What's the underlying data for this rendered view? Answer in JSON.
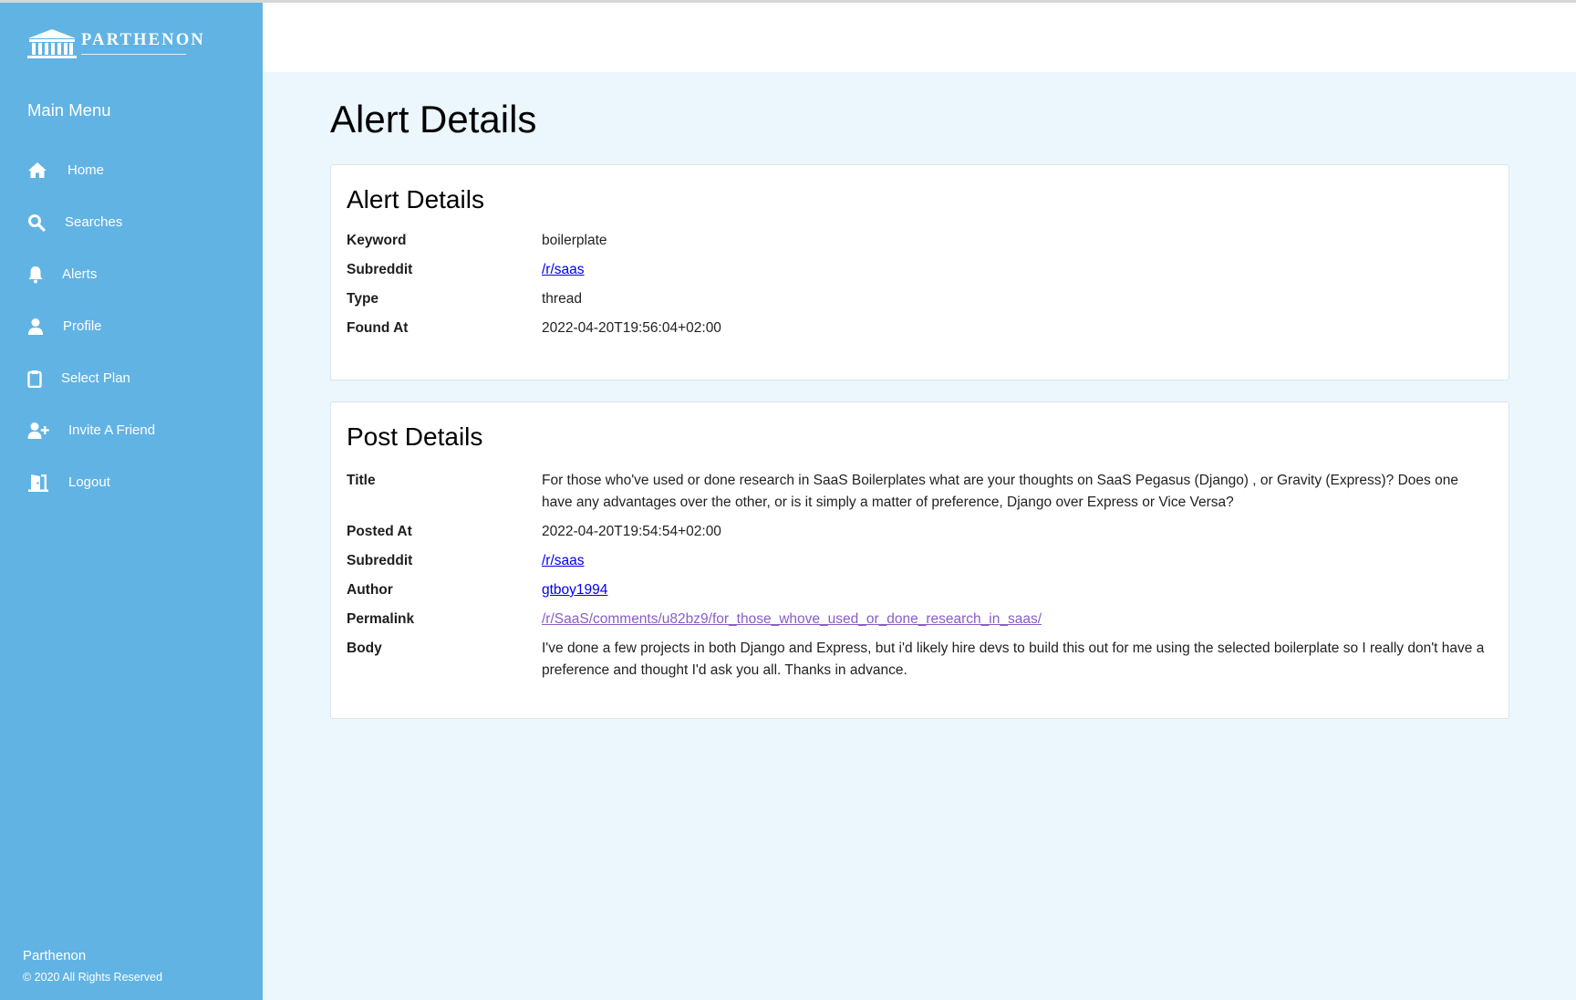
{
  "brand": {
    "logo_text": "PARTHENON"
  },
  "sidebar": {
    "menu_title": "Main Menu",
    "items": [
      {
        "label": "Home",
        "icon": "home-icon"
      },
      {
        "label": "Searches",
        "icon": "search-icon"
      },
      {
        "label": "Alerts",
        "icon": "bell-icon"
      },
      {
        "label": "Profile",
        "icon": "user-icon"
      },
      {
        "label": "Select Plan",
        "icon": "clipboard-icon"
      },
      {
        "label": "Invite A Friend",
        "icon": "user-plus-icon"
      },
      {
        "label": "Logout",
        "icon": "door-exit-icon"
      }
    ],
    "footer_name": "Parthenon",
    "footer_copy": "© 2020 All Rights Reserved"
  },
  "page": {
    "title": "Alert Details"
  },
  "alert": {
    "heading": "Alert Details",
    "keyword_label": "Keyword",
    "keyword": "boilerplate",
    "subreddit_label": "Subreddit",
    "subreddit": "/r/saas",
    "type_label": "Type",
    "type": "thread",
    "found_label": "Found At",
    "found_at": "2022-04-20T19:56:04+02:00"
  },
  "post": {
    "heading": "Post Details",
    "title_label": "Title",
    "title": "For those who've used or done research in SaaS Boilerplates what are your thoughts on SaaS Pegasus (Django) , or Gravity (Express)? Does one have any advantages over the other, or is it simply a matter of preference, Django over Express or Vice Versa?",
    "posted_label": "Posted At",
    "posted_at": "2022-04-20T19:54:54+02:00",
    "subreddit_label": "Subreddit",
    "subreddit": "/r/saas",
    "author_label": "Author",
    "author": "gtboy1994",
    "permalink_label": "Permalink",
    "permalink": "/r/SaaS/comments/u82bz9/for_those_whove_used_or_done_research_in_saas/",
    "body_label": "Body",
    "body": "I've done a few projects in both Django and Express, but i'd likely hire devs to build this out for me using the selected boilerplate so I really don't have a preference and thought I'd ask you all. Thanks in advance."
  },
  "colors": {
    "sidebar": "#61b3e4",
    "content_bg": "#ebf6fd",
    "link": "#0000ee",
    "visited_link": "#8a5cc8"
  }
}
